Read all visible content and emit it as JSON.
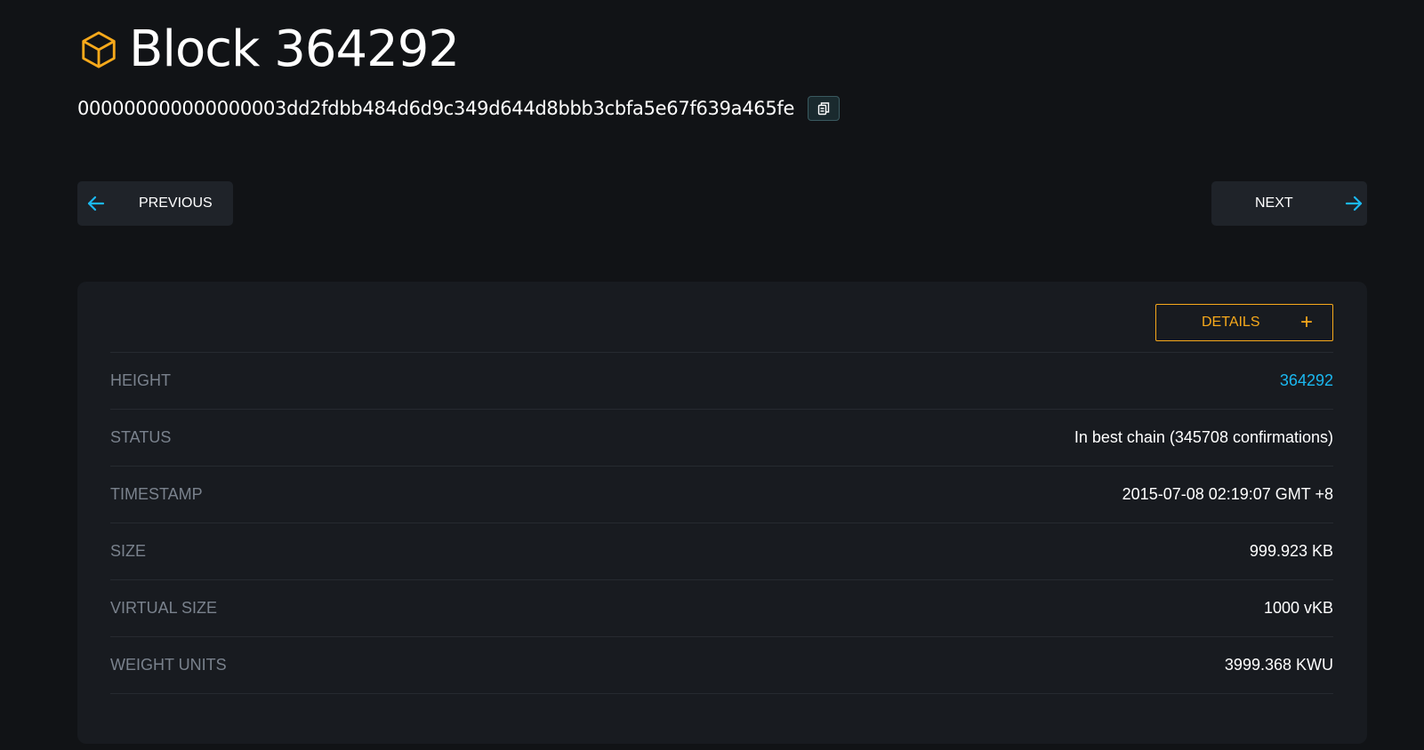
{
  "header": {
    "title": "Block 364292",
    "hash": "000000000000000003dd2fdbb484d6d9c349d644d8bbb3cbfa5e67f639a465fe",
    "icon": "cube-icon",
    "icon_color": "#f7a91b"
  },
  "nav": {
    "previous_label": "PREVIOUS",
    "next_label": "NEXT",
    "arrow_color": "#1bb8f0"
  },
  "details": {
    "button_label": "DETAILS",
    "button_icon": "+",
    "accent_color": "#f7a91b"
  },
  "rows": [
    {
      "label": "HEIGHT",
      "value": "364292"
    },
    {
      "label": "STATUS",
      "value": "In best chain (345708 confirmations)"
    },
    {
      "label": "TIMESTAMP",
      "value": "2015-07-08 02:19:07 GMT +8"
    },
    {
      "label": "SIZE",
      "value": "999.923 KB"
    },
    {
      "label": "VIRTUAL SIZE",
      "value": "1000 vKB"
    },
    {
      "label": "WEIGHT UNITS",
      "value": "3999.368 KWU"
    }
  ]
}
